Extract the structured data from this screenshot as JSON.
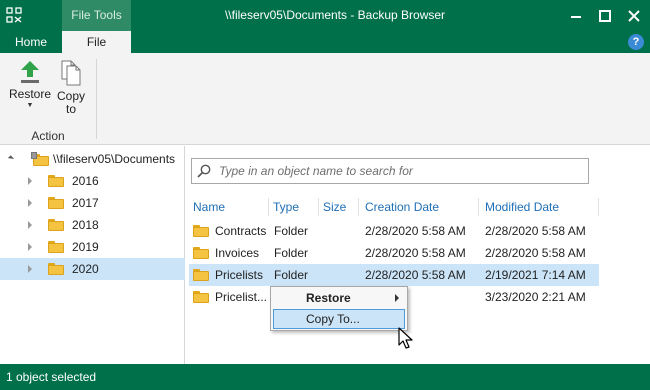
{
  "window": {
    "title": "\\\\fileserv05\\Documents - Backup Browser",
    "contextual_tab": "File Tools",
    "tabs": {
      "home": "Home",
      "file": "File"
    },
    "help": "?"
  },
  "ribbon": {
    "restore_label": "Restore",
    "restore_arrow": "▼",
    "copy_label_1": "Copy",
    "copy_label_2": "to",
    "group_label": "Action"
  },
  "tree": {
    "root": "\\\\fileserv05\\Documents",
    "items": [
      "2016",
      "2017",
      "2018",
      "2019",
      "2020"
    ],
    "selected": "2020"
  },
  "search": {
    "placeholder": "Type in an object name to search for"
  },
  "table": {
    "headers": {
      "name": "Name",
      "type": "Type",
      "size": "Size",
      "created": "Creation Date",
      "modified": "Modified Date"
    },
    "rows": [
      {
        "name": "Contracts",
        "type": "Folder",
        "size": "",
        "created": "2/28/2020 5:58 AM",
        "modified": "2/28/2020 5:58 AM"
      },
      {
        "name": "Invoices",
        "type": "Folder",
        "size": "",
        "created": "2/28/2020 5:58 AM",
        "modified": "2/28/2020 5:58 AM"
      },
      {
        "name": "Pricelists",
        "type": "Folder",
        "size": "",
        "created": "2/28/2020 5:58 AM",
        "modified": "2/19/2021 7:14 AM"
      },
      {
        "name": "Pricelist...",
        "type": "",
        "size": "",
        "created": "",
        "modified": "3/23/2020 2:21 AM"
      }
    ]
  },
  "context_menu": {
    "restore": "Restore",
    "copy_to": "Copy To..."
  },
  "status": {
    "text": "1 object selected"
  },
  "colors": {
    "brand": "#00704a",
    "selection": "#cce4f7",
    "folder": "#f5c342"
  }
}
